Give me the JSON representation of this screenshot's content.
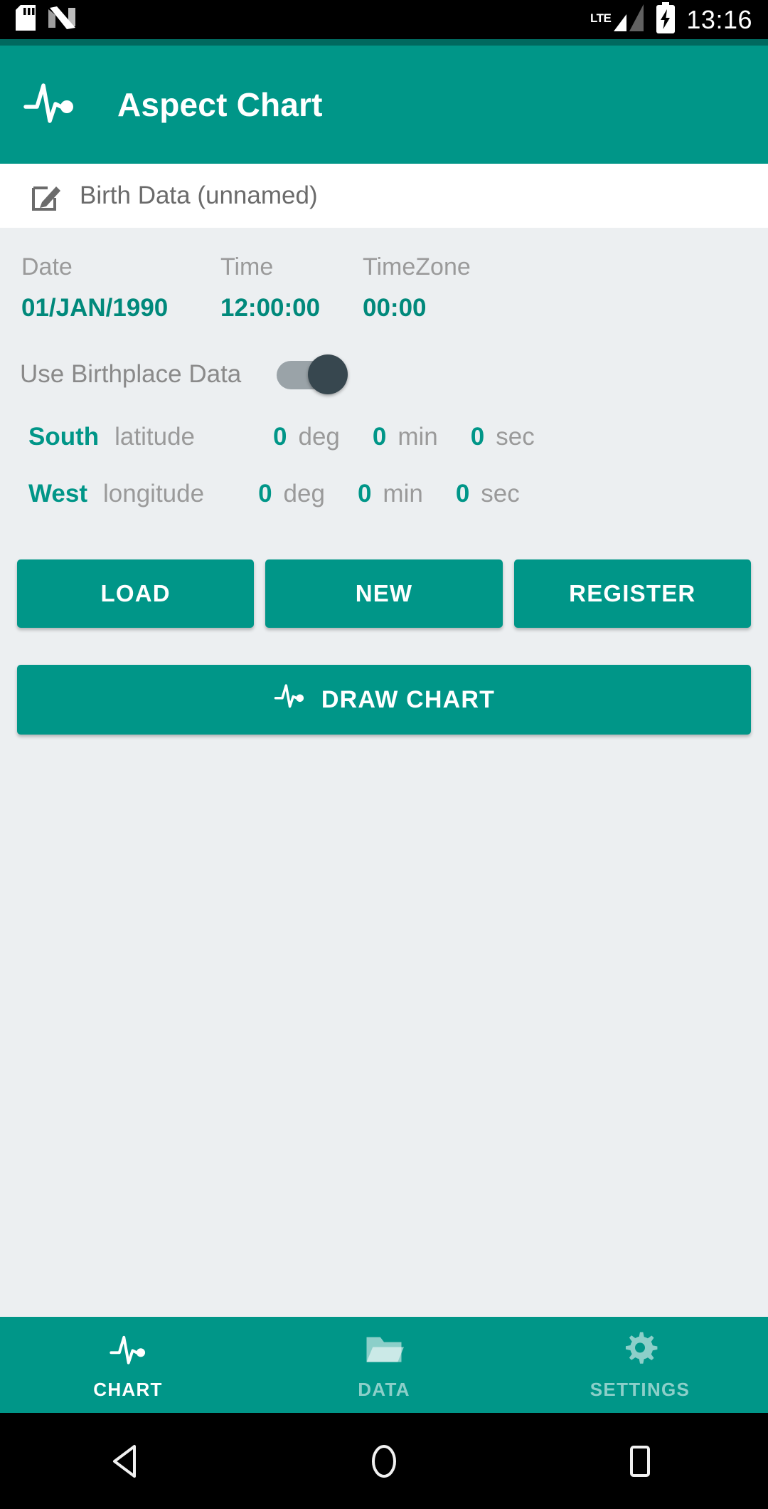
{
  "statusbar": {
    "sd_icon": "sd-card-icon",
    "android_icon": "android-nougat-icon",
    "network_label": "LTE",
    "signal_icon": "signal-bars-icon",
    "battery_icon": "battery-charging-icon",
    "clock": "13:16"
  },
  "appbar": {
    "logo_icon": "pulse-chart-icon",
    "title": "Aspect Chart",
    "background": "#009688"
  },
  "birth_header": {
    "edit_icon": "edit-pencil-icon",
    "label": "Birth Data (unnamed)"
  },
  "datetime": {
    "headers": [
      "Date",
      "Time",
      "TimeZone"
    ],
    "date": "01/JAN/1990",
    "time": "12:00:00",
    "timezone": "00:00"
  },
  "birthplace": {
    "toggle_label": "Use Birthplace Data",
    "toggle_state": "off",
    "latitude": {
      "direction": "South",
      "name": "latitude",
      "deg": "0",
      "deg_unit": "deg",
      "min": "0",
      "min_unit": "min",
      "sec": "0",
      "sec_unit": "sec"
    },
    "longitude": {
      "direction": "West",
      "name": "longitude",
      "deg": "0",
      "deg_unit": "deg",
      "min": "0",
      "min_unit": "min",
      "sec": "0",
      "sec_unit": "sec"
    }
  },
  "actions": {
    "load": "LOAD",
    "new": "NEW",
    "register": "REGISTER",
    "draw_chart": "DRAW CHART",
    "draw_chart_icon": "pulse-chart-icon"
  },
  "bottomnav": {
    "items": [
      {
        "label": "CHART",
        "icon": "pulse-chart-icon",
        "active": true
      },
      {
        "label": "DATA",
        "icon": "folder-icon",
        "active": false
      },
      {
        "label": "SETTINGS",
        "icon": "gear-icon",
        "active": false
      }
    ]
  },
  "androidnav": {
    "back_icon": "back-triangle-icon",
    "home_icon": "home-circle-icon",
    "recents_icon": "recents-square-icon"
  },
  "colors": {
    "accent": "#009688",
    "accent_dark": "#00695f",
    "value_text": "#00897b",
    "content_bg": "#eceff1",
    "muted_text": "#9a9a9a",
    "switch_thumb": "#37474f",
    "switch_track": "#9aa3a8"
  }
}
